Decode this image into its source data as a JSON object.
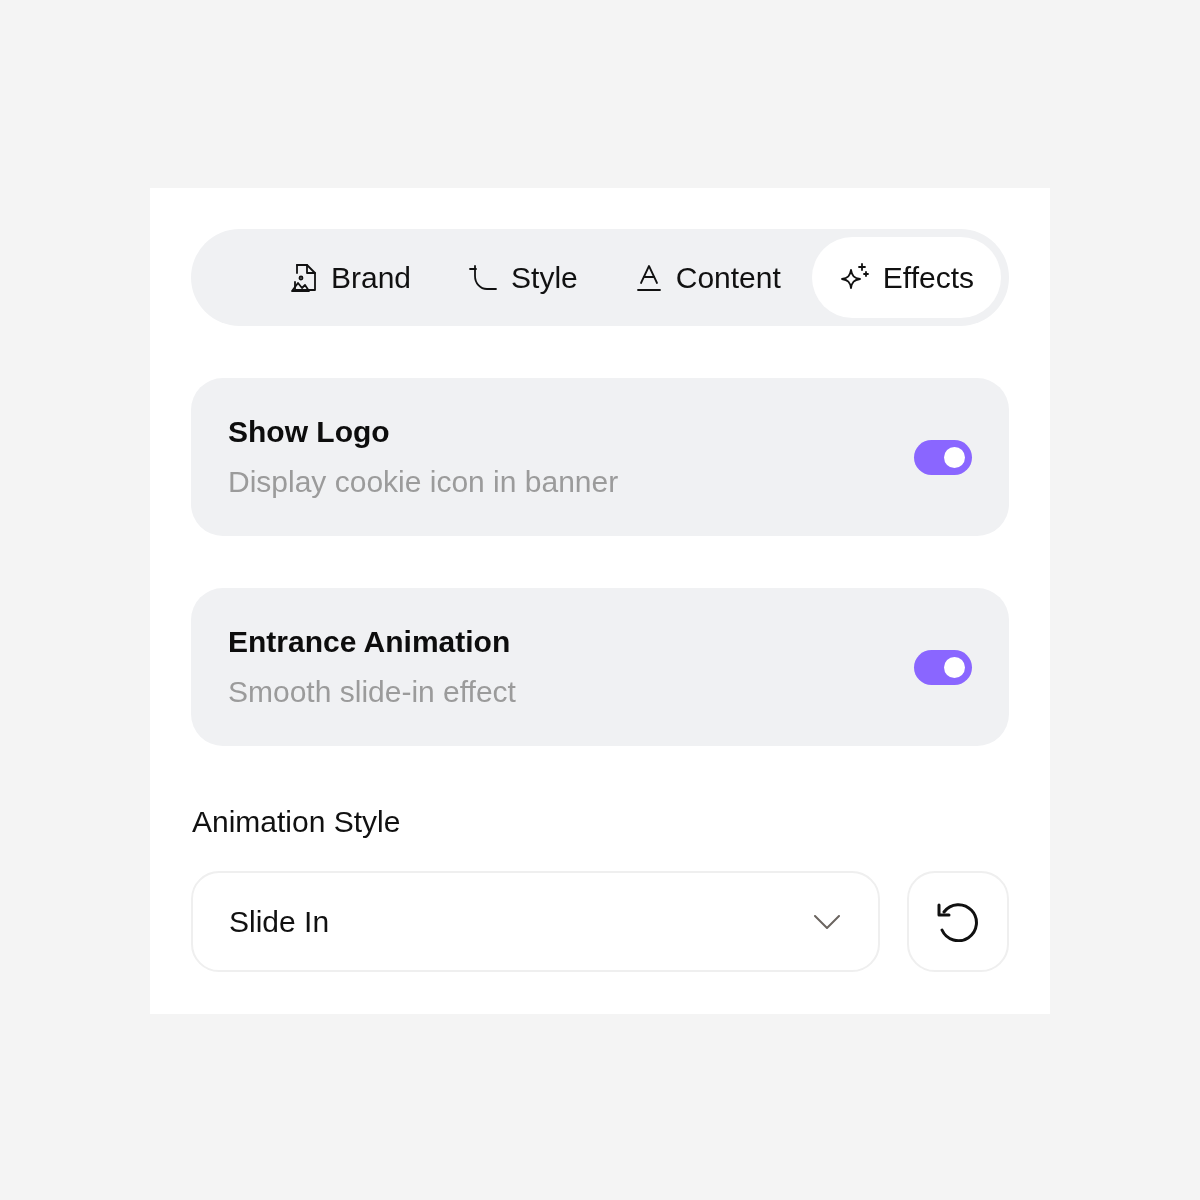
{
  "tabs": [
    {
      "label": "Brand",
      "selected": false
    },
    {
      "label": "Style",
      "selected": false
    },
    {
      "label": "Content",
      "selected": false
    },
    {
      "label": "Effects",
      "selected": true
    }
  ],
  "settings": [
    {
      "title": "Show Logo",
      "description": "Display cookie icon in banner",
      "on": true
    },
    {
      "title": "Entrance Animation",
      "description": "Smooth slide-in effect",
      "on": true
    }
  ],
  "animation_style": {
    "label": "Animation Style",
    "value": "Slide In"
  }
}
